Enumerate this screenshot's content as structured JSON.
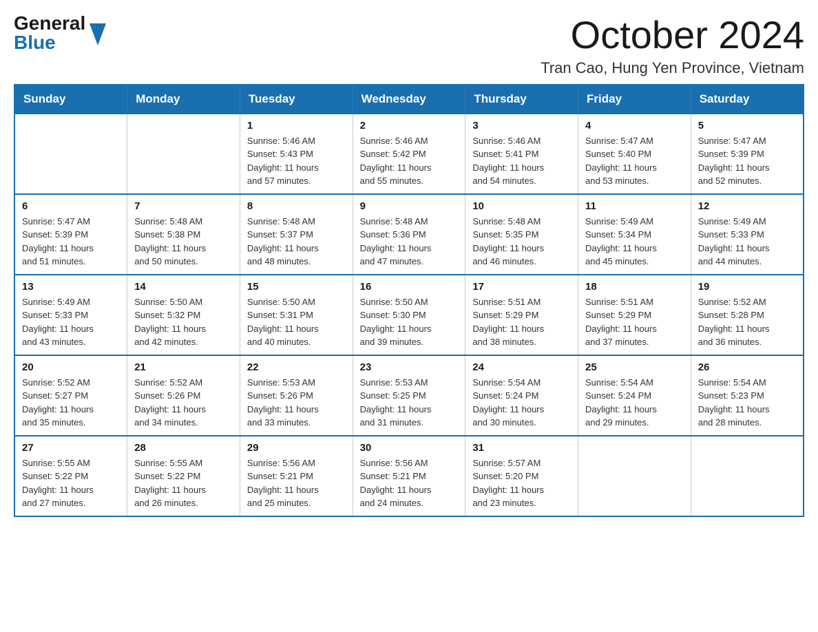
{
  "logo": {
    "general": "General",
    "blue": "Blue"
  },
  "title": "October 2024",
  "subtitle": "Tran Cao, Hung Yen Province, Vietnam",
  "days_of_week": [
    "Sunday",
    "Monday",
    "Tuesday",
    "Wednesday",
    "Thursday",
    "Friday",
    "Saturday"
  ],
  "weeks": [
    [
      {
        "day": "",
        "info": ""
      },
      {
        "day": "",
        "info": ""
      },
      {
        "day": "1",
        "info": "Sunrise: 5:46 AM\nSunset: 5:43 PM\nDaylight: 11 hours\nand 57 minutes."
      },
      {
        "day": "2",
        "info": "Sunrise: 5:46 AM\nSunset: 5:42 PM\nDaylight: 11 hours\nand 55 minutes."
      },
      {
        "day": "3",
        "info": "Sunrise: 5:46 AM\nSunset: 5:41 PM\nDaylight: 11 hours\nand 54 minutes."
      },
      {
        "day": "4",
        "info": "Sunrise: 5:47 AM\nSunset: 5:40 PM\nDaylight: 11 hours\nand 53 minutes."
      },
      {
        "day": "5",
        "info": "Sunrise: 5:47 AM\nSunset: 5:39 PM\nDaylight: 11 hours\nand 52 minutes."
      }
    ],
    [
      {
        "day": "6",
        "info": "Sunrise: 5:47 AM\nSunset: 5:39 PM\nDaylight: 11 hours\nand 51 minutes."
      },
      {
        "day": "7",
        "info": "Sunrise: 5:48 AM\nSunset: 5:38 PM\nDaylight: 11 hours\nand 50 minutes."
      },
      {
        "day": "8",
        "info": "Sunrise: 5:48 AM\nSunset: 5:37 PM\nDaylight: 11 hours\nand 48 minutes."
      },
      {
        "day": "9",
        "info": "Sunrise: 5:48 AM\nSunset: 5:36 PM\nDaylight: 11 hours\nand 47 minutes."
      },
      {
        "day": "10",
        "info": "Sunrise: 5:48 AM\nSunset: 5:35 PM\nDaylight: 11 hours\nand 46 minutes."
      },
      {
        "day": "11",
        "info": "Sunrise: 5:49 AM\nSunset: 5:34 PM\nDaylight: 11 hours\nand 45 minutes."
      },
      {
        "day": "12",
        "info": "Sunrise: 5:49 AM\nSunset: 5:33 PM\nDaylight: 11 hours\nand 44 minutes."
      }
    ],
    [
      {
        "day": "13",
        "info": "Sunrise: 5:49 AM\nSunset: 5:33 PM\nDaylight: 11 hours\nand 43 minutes."
      },
      {
        "day": "14",
        "info": "Sunrise: 5:50 AM\nSunset: 5:32 PM\nDaylight: 11 hours\nand 42 minutes."
      },
      {
        "day": "15",
        "info": "Sunrise: 5:50 AM\nSunset: 5:31 PM\nDaylight: 11 hours\nand 40 minutes."
      },
      {
        "day": "16",
        "info": "Sunrise: 5:50 AM\nSunset: 5:30 PM\nDaylight: 11 hours\nand 39 minutes."
      },
      {
        "day": "17",
        "info": "Sunrise: 5:51 AM\nSunset: 5:29 PM\nDaylight: 11 hours\nand 38 minutes."
      },
      {
        "day": "18",
        "info": "Sunrise: 5:51 AM\nSunset: 5:29 PM\nDaylight: 11 hours\nand 37 minutes."
      },
      {
        "day": "19",
        "info": "Sunrise: 5:52 AM\nSunset: 5:28 PM\nDaylight: 11 hours\nand 36 minutes."
      }
    ],
    [
      {
        "day": "20",
        "info": "Sunrise: 5:52 AM\nSunset: 5:27 PM\nDaylight: 11 hours\nand 35 minutes."
      },
      {
        "day": "21",
        "info": "Sunrise: 5:52 AM\nSunset: 5:26 PM\nDaylight: 11 hours\nand 34 minutes."
      },
      {
        "day": "22",
        "info": "Sunrise: 5:53 AM\nSunset: 5:26 PM\nDaylight: 11 hours\nand 33 minutes."
      },
      {
        "day": "23",
        "info": "Sunrise: 5:53 AM\nSunset: 5:25 PM\nDaylight: 11 hours\nand 31 minutes."
      },
      {
        "day": "24",
        "info": "Sunrise: 5:54 AM\nSunset: 5:24 PM\nDaylight: 11 hours\nand 30 minutes."
      },
      {
        "day": "25",
        "info": "Sunrise: 5:54 AM\nSunset: 5:24 PM\nDaylight: 11 hours\nand 29 minutes."
      },
      {
        "day": "26",
        "info": "Sunrise: 5:54 AM\nSunset: 5:23 PM\nDaylight: 11 hours\nand 28 minutes."
      }
    ],
    [
      {
        "day": "27",
        "info": "Sunrise: 5:55 AM\nSunset: 5:22 PM\nDaylight: 11 hours\nand 27 minutes."
      },
      {
        "day": "28",
        "info": "Sunrise: 5:55 AM\nSunset: 5:22 PM\nDaylight: 11 hours\nand 26 minutes."
      },
      {
        "day": "29",
        "info": "Sunrise: 5:56 AM\nSunset: 5:21 PM\nDaylight: 11 hours\nand 25 minutes."
      },
      {
        "day": "30",
        "info": "Sunrise: 5:56 AM\nSunset: 5:21 PM\nDaylight: 11 hours\nand 24 minutes."
      },
      {
        "day": "31",
        "info": "Sunrise: 5:57 AM\nSunset: 5:20 PM\nDaylight: 11 hours\nand 23 minutes."
      },
      {
        "day": "",
        "info": ""
      },
      {
        "day": "",
        "info": ""
      }
    ]
  ]
}
